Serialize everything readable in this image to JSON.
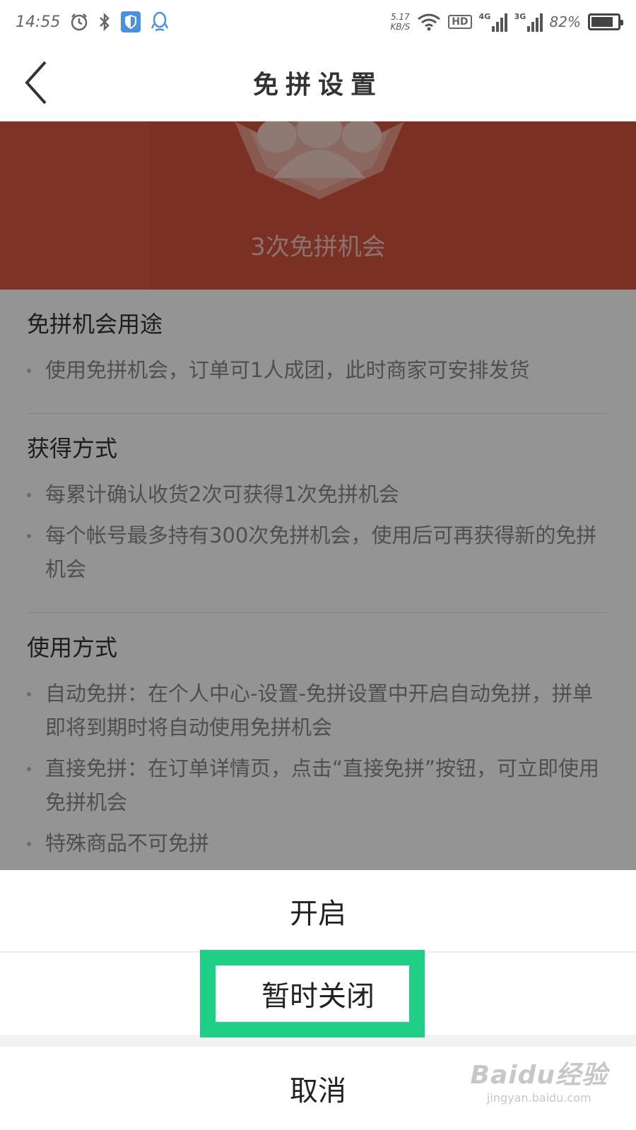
{
  "status_bar": {
    "time": "14:55",
    "net_speed_value": "5.17",
    "net_speed_unit": "KB/S",
    "hd_label": "HD",
    "net1_label": "4G",
    "net2_label": "3G",
    "battery_percent": "82%",
    "battery_level": 0.82,
    "icons": [
      "alarm-icon",
      "bluetooth-icon",
      "shield-app-icon",
      "qq-icon",
      "wifi-icon",
      "signal-icon",
      "battery-icon"
    ]
  },
  "header": {
    "title": "免拼设置"
  },
  "banner": {
    "text": "3次免拼机会",
    "color": "#d2533c"
  },
  "sections": [
    {
      "title": "免拼机会用途",
      "items": [
        "使用免拼机会，订单可1人成团，此时商家可安排发货"
      ]
    },
    {
      "title": "获得方式",
      "items": [
        "每累计确认收货2次可获得1次免拼机会",
        "每个帐号最多持有300次免拼机会，使用后可再获得新的免拼机会"
      ]
    },
    {
      "title": "使用方式",
      "items": [
        "自动免拼：在个人中心-设置-免拼设置中开启自动免拼，拼单即将到期时将自动使用免拼机会",
        "直接免拼：在订单详情页，点击“直接免拼”按钮，可立即使用免拼机会",
        "特殊商品不可免拼"
      ]
    }
  ],
  "action_sheet": {
    "open_label": "开启",
    "close_label": "暂时关闭",
    "cancel_label": "取消"
  },
  "highlight_color": "#1fcf85",
  "watermark": {
    "logo": "Baidu经验",
    "url": "jingyan.baidu.com"
  }
}
